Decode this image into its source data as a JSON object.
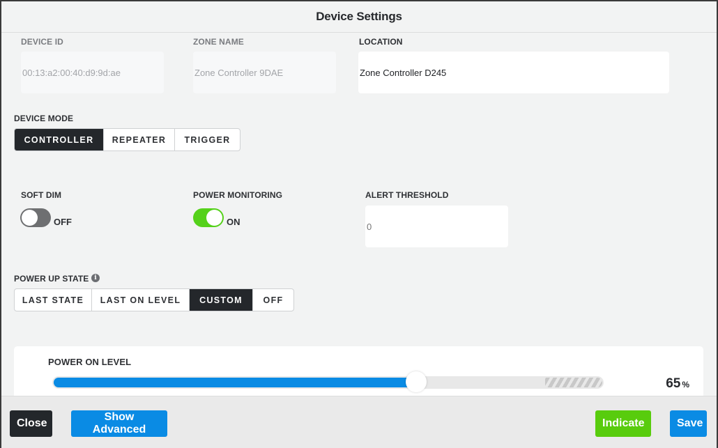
{
  "header": {
    "title": "Device Settings"
  },
  "fields": {
    "device_id": {
      "label": "DEVICE ID",
      "value": "00:13:a2:00:40:d9:9d:ae"
    },
    "zone_name": {
      "label": "ZONE NAME",
      "value": "Zone Controller 9DAE"
    },
    "location": {
      "label": "LOCATION",
      "value": "Zone Controller D245"
    }
  },
  "device_mode": {
    "label": "DEVICE MODE",
    "options": [
      "CONTROLLER",
      "REPEATER",
      "TRIGGER"
    ],
    "selected": "CONTROLLER"
  },
  "soft_dim": {
    "label": "SOFT DIM",
    "state": "OFF"
  },
  "power_monitoring": {
    "label": "POWER MONITORING",
    "state": "ON"
  },
  "alert_threshold": {
    "label": "ALERT THRESHOLD",
    "placeholder": "0"
  },
  "power_up_state": {
    "label": "POWER UP STATE",
    "info_icon": "info-icon",
    "options": [
      "LAST STATE",
      "LAST ON LEVEL",
      "CUSTOM",
      "OFF"
    ],
    "selected": "CUSTOM"
  },
  "power_on_level": {
    "label": "POWER ON LEVEL",
    "value": 65,
    "unit": "%",
    "value_text": "65"
  },
  "footer": {
    "close": "Close",
    "show_advanced": "Show Advanced",
    "indicate": "Indicate",
    "save": "Save"
  },
  "colors": {
    "accent_blue": "#0a8be4",
    "accent_green": "#58cc0d",
    "toggle_on": "#55d11a",
    "dark": "#23272b"
  }
}
